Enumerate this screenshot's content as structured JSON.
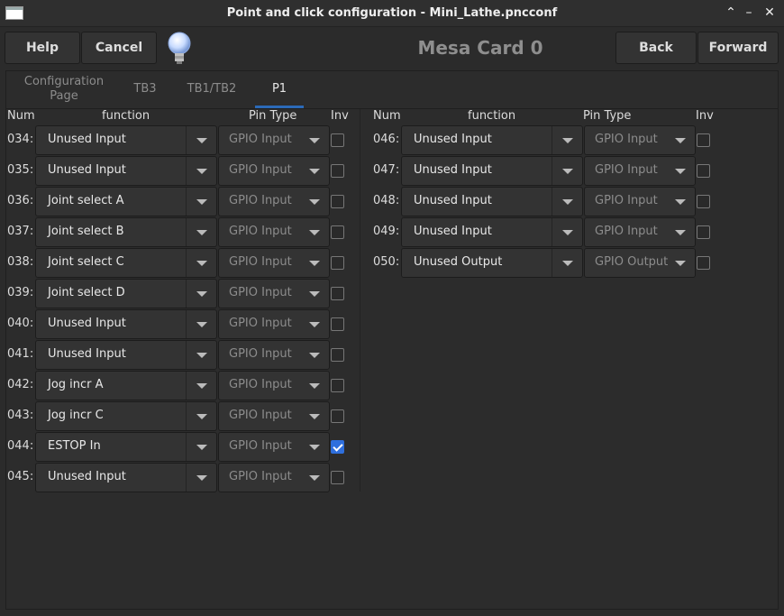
{
  "window": {
    "title": "Point and click configuration - Mini_Lathe.pncconf"
  },
  "toolbar": {
    "help": "Help",
    "cancel": "Cancel",
    "back": "Back",
    "forward": "Forward",
    "card_title": "Mesa Card 0"
  },
  "tabs": [
    {
      "label": "Configuration Page",
      "active": false
    },
    {
      "label": "TB3",
      "active": false
    },
    {
      "label": "TB1/TB2",
      "active": false
    },
    {
      "label": "P1",
      "active": true
    }
  ],
  "headers": {
    "num": "Num",
    "function": "function",
    "pin_type": "Pin Type",
    "inv": "Inv"
  },
  "left_pins": [
    {
      "num": "034:",
      "function": "Unused Input",
      "pin_type": "GPIO Input",
      "inv": false
    },
    {
      "num": "035:",
      "function": "Unused Input",
      "pin_type": "GPIO Input",
      "inv": false
    },
    {
      "num": "036:",
      "function": "Joint select A",
      "pin_type": "GPIO Input",
      "inv": false
    },
    {
      "num": "037:",
      "function": "Joint select B",
      "pin_type": "GPIO Input",
      "inv": false
    },
    {
      "num": "038:",
      "function": "Joint select C",
      "pin_type": "GPIO Input",
      "inv": false
    },
    {
      "num": "039:",
      "function": "Joint select D",
      "pin_type": "GPIO Input",
      "inv": false
    },
    {
      "num": "040:",
      "function": "Unused Input",
      "pin_type": "GPIO Input",
      "inv": false
    },
    {
      "num": "041:",
      "function": "Unused Input",
      "pin_type": "GPIO Input",
      "inv": false
    },
    {
      "num": "042:",
      "function": "Jog incr A",
      "pin_type": "GPIO Input",
      "inv": false
    },
    {
      "num": "043:",
      "function": "Jog incr C",
      "pin_type": "GPIO Input",
      "inv": false
    },
    {
      "num": "044:",
      "function": "ESTOP In",
      "pin_type": "GPIO Input",
      "inv": true
    },
    {
      "num": "045:",
      "function": "Unused Input",
      "pin_type": "GPIO Input",
      "inv": false
    }
  ],
  "right_pins": [
    {
      "num": "046:",
      "function": "Unused Input",
      "pin_type": "GPIO Input",
      "inv": false
    },
    {
      "num": "047:",
      "function": "Unused Input",
      "pin_type": "GPIO Input",
      "inv": false
    },
    {
      "num": "048:",
      "function": "Unused Input",
      "pin_type": "GPIO Input",
      "inv": false
    },
    {
      "num": "049:",
      "function": "Unused Input",
      "pin_type": "GPIO Input",
      "inv": false
    },
    {
      "num": "050:",
      "function": "Unused Output",
      "pin_type": "GPIO Output",
      "inv": false
    }
  ],
  "icons": {
    "window": "window-icon",
    "bulb": "lightbulb-icon",
    "dropdown": "chevron-down-icon"
  },
  "colors": {
    "accent": "#2b6ab8",
    "checkbox_checked": "#2f6fdd",
    "background": "#2b2b2b"
  }
}
